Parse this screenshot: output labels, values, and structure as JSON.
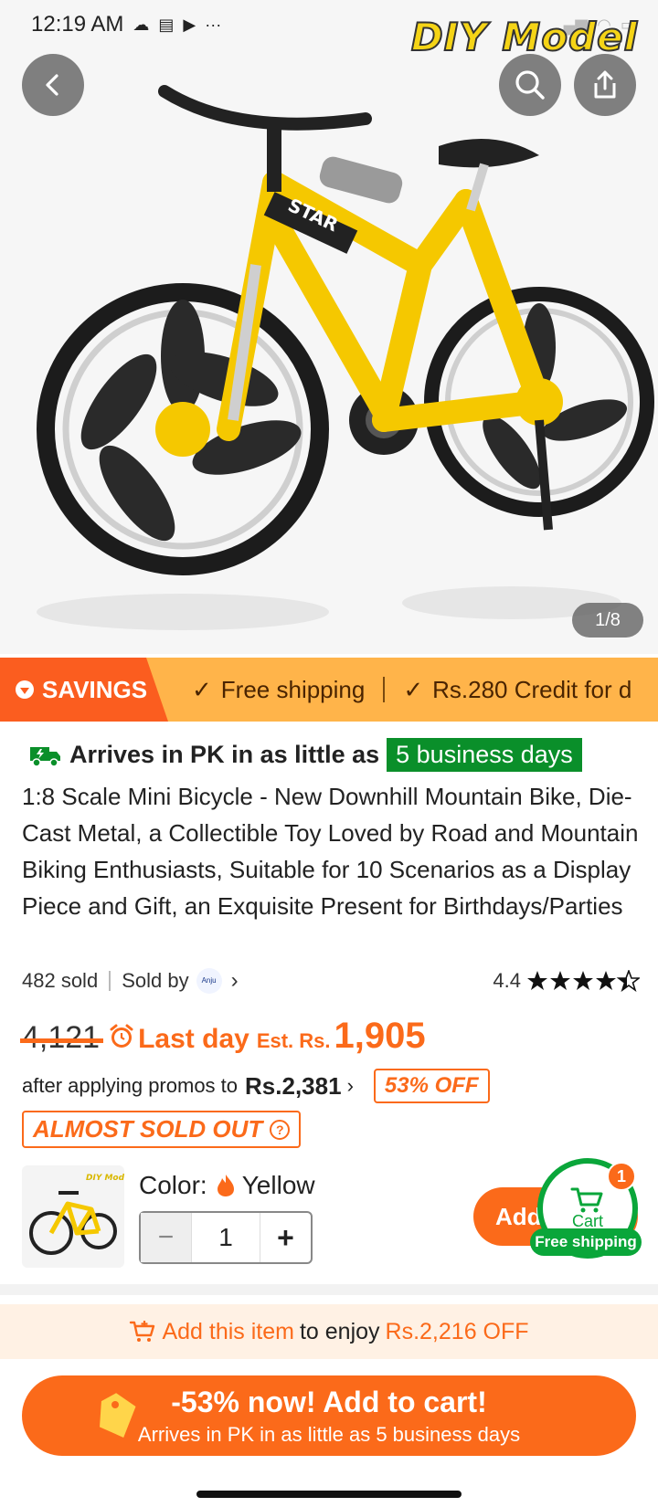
{
  "status_bar": {
    "time": "12:19 AM"
  },
  "hero": {
    "brand_watermark": "DIY Model",
    "pager": "1/8"
  },
  "savings_strip": {
    "tag": "SAVINGS",
    "items": [
      "Free shipping",
      "Rs.280 Credit for d"
    ]
  },
  "arrival": {
    "prefix": "Arrives in PK in as little as",
    "days": "5 business days"
  },
  "product": {
    "title": "1:8 Scale Mini Bicycle - New Downhill Mountain Bike, Die-Cast Metal, a Collectible Toy Loved by Road and Mountain Biking Enthusiasts, Suitable for 10 Scenarios as a Display Piece and Gift, an Exquisite Present for Birthdays/Parties",
    "sold": "482 sold",
    "sold_by": "Sold by",
    "seller_logo_text": "Anju",
    "rating": "4.4",
    "stars": 4.4
  },
  "price": {
    "original": "4,121",
    "last_day": "Last day",
    "est_label": "Est. Rs.",
    "est_value": "1,905",
    "promo_prefix": "after applying promos to",
    "promo_amount": "Rs.2,381",
    "discount_badge": "53% OFF",
    "stock_badge": "ALMOST SOLD OUT"
  },
  "variant": {
    "color_label": "Color:",
    "color_value": "Yellow",
    "quantity": "1",
    "add_label": "Add"
  },
  "cart_fab": {
    "label": "Cart",
    "count": "1",
    "free_shipping": "Free shipping"
  },
  "enjoy_bar": {
    "link": "Add this item",
    "middle": "to enjoy",
    "amount": "Rs.2,216 OFF"
  },
  "cta": {
    "line1": "-53% now! Add to cart!",
    "line2": "Arrives in PK in as little as 5 business days"
  },
  "colors": {
    "accent": "#fb6a1a",
    "green": "#0a8f2a",
    "savings_bg": "#ffb44a",
    "bike_yellow": "#f5c800"
  }
}
